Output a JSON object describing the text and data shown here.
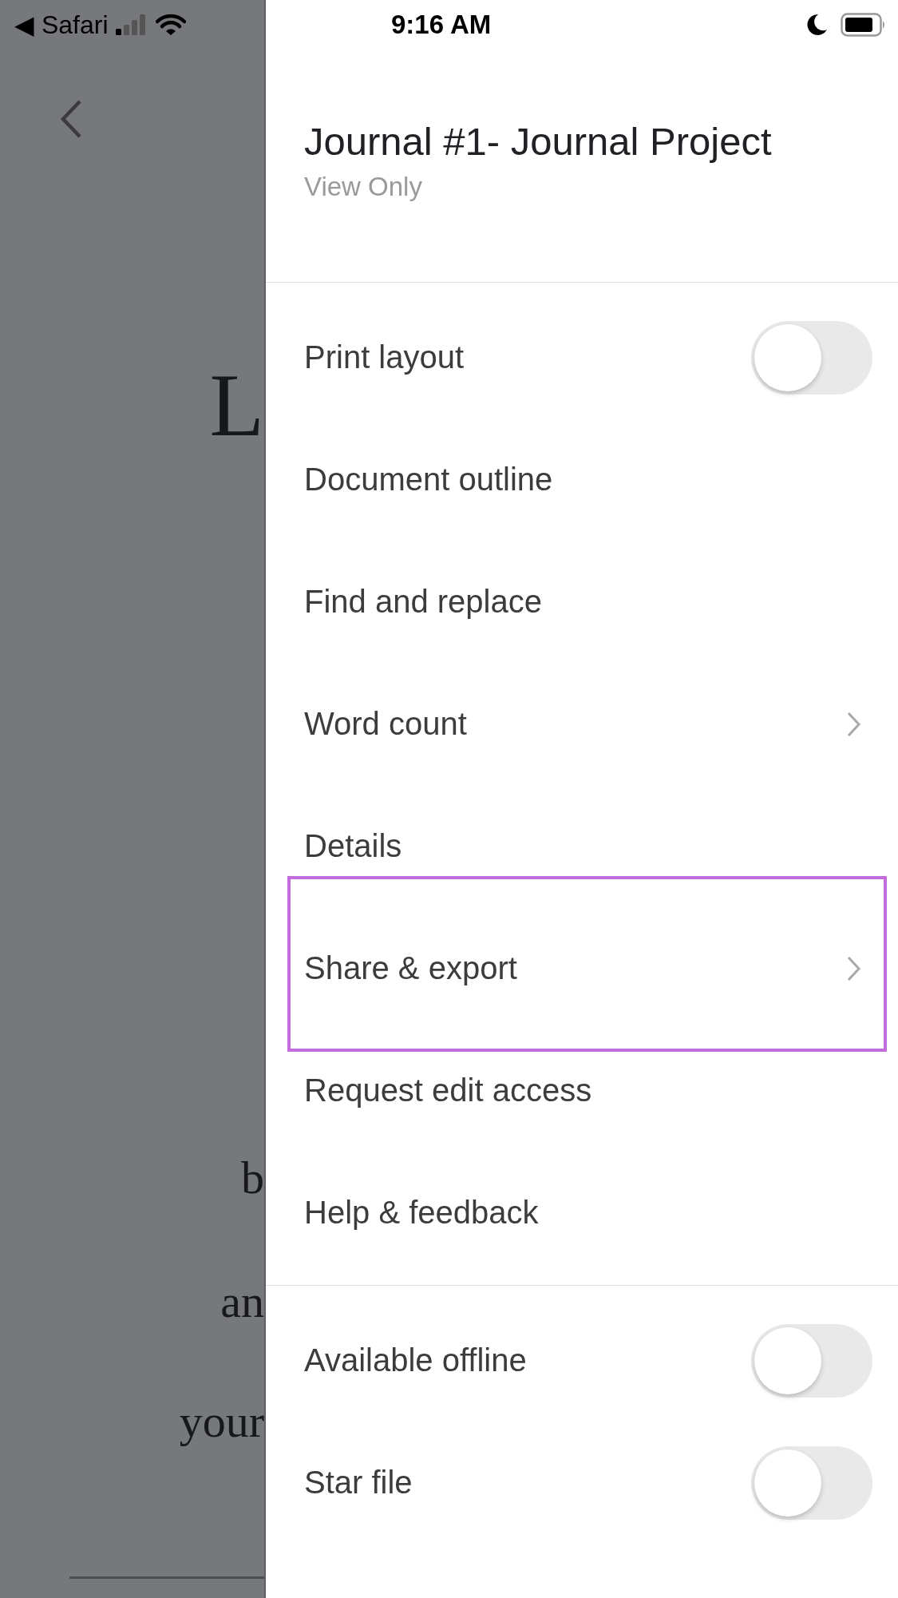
{
  "status_bar": {
    "back_app": "◀ Safari",
    "time": "9:16 AM"
  },
  "background_document": {
    "lines": [
      "L",
      "b",
      "an",
      "your"
    ]
  },
  "menu": {
    "title": "Journal #1- Journal Project",
    "subtitle": "View Only",
    "groups": [
      {
        "items": [
          {
            "label": "Print layout",
            "kind": "toggle",
            "on": false,
            "highlighted": false
          },
          {
            "label": "Document outline",
            "kind": "plain",
            "highlighted": false
          },
          {
            "label": "Find and replace",
            "kind": "plain",
            "highlighted": false
          },
          {
            "label": "Word count",
            "kind": "submenu",
            "highlighted": false
          },
          {
            "label": "Details",
            "kind": "plain",
            "highlighted": false
          },
          {
            "label": "Share & export",
            "kind": "submenu",
            "highlighted": true
          },
          {
            "label": "Request edit access",
            "kind": "plain",
            "highlighted": false
          },
          {
            "label": "Help & feedback",
            "kind": "plain",
            "highlighted": false
          }
        ]
      },
      {
        "items": [
          {
            "label": "Available offline",
            "kind": "toggle",
            "on": false,
            "highlighted": false
          },
          {
            "label": "Star file",
            "kind": "toggle",
            "on": false,
            "highlighted": false
          }
        ]
      }
    ]
  }
}
